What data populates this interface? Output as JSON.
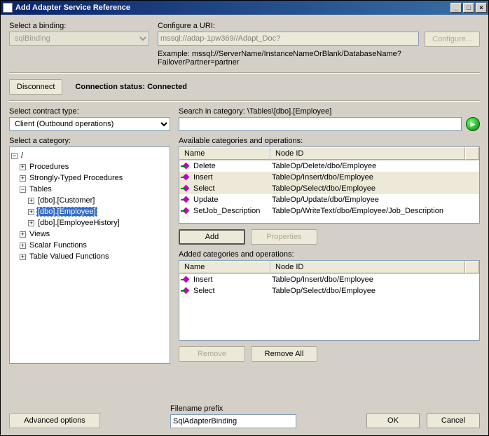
{
  "title": "Add Adapter Service Reference",
  "labels": {
    "select_binding": "Select a binding:",
    "configure_uri": "Configure a URI:",
    "example": "Example: mssql://ServerName/InstanceNameOrBlank/DatabaseName?FailoverPartner=partner",
    "connection_status_label": "Connection status:",
    "connection_status_value": "Connected",
    "select_contract": "Select contract type:",
    "search_in_category": "Search in category: \\Tables\\[dbo].[Employee]",
    "select_category": "Select a category:",
    "available_ops": "Available categories and operations:",
    "added_ops": "Added categories and operations:",
    "filename_prefix": "Filename prefix"
  },
  "buttons": {
    "configure": "Configure...",
    "disconnect": "Disconnect",
    "add": "Add",
    "properties": "Properties",
    "remove": "Remove",
    "remove_all": "Remove All",
    "advanced": "Advanced options",
    "ok": "OK",
    "cancel": "Cancel"
  },
  "fields": {
    "binding": "sqlBinding",
    "uri": "mssql://adap-1pw369//Adapt_Doc?",
    "contract": "Client (Outbound operations)",
    "search": "",
    "filename_prefix": "SqlAdapterBinding"
  },
  "tree": {
    "root": "/",
    "items": {
      "procedures": "Procedures",
      "strongly_typed": "Strongly-Typed Procedures",
      "tables": "Tables",
      "customer": "[dbo].[Customer]",
      "employee": "[dbo].[Employee]",
      "employee_history": "[dbo].[EmployeeHistory]",
      "views": "Views",
      "scalar_fn": "Scalar Functions",
      "table_valued_fn": "Table Valued Functions"
    }
  },
  "cols": {
    "name": "Name",
    "node_id": "Node ID"
  },
  "available": [
    {
      "name": "Delete",
      "node_id": "TableOp/Delete/dbo/Employee"
    },
    {
      "name": "Insert",
      "node_id": "TableOp/Insert/dbo/Employee"
    },
    {
      "name": "Select",
      "node_id": "TableOp/Select/dbo/Employee"
    },
    {
      "name": "Update",
      "node_id": "TableOp/Update/dbo/Employee"
    },
    {
      "name": "SetJob_Description",
      "node_id": "TableOp/WriteText/dbo/Employee/Job_Description"
    }
  ],
  "added": [
    {
      "name": "Insert",
      "node_id": "TableOp/Insert/dbo/Employee"
    },
    {
      "name": "Select",
      "node_id": "TableOp/Select/dbo/Employee"
    }
  ],
  "titlebar_symbols": {
    "min": "_",
    "max": "□",
    "close": "×"
  }
}
